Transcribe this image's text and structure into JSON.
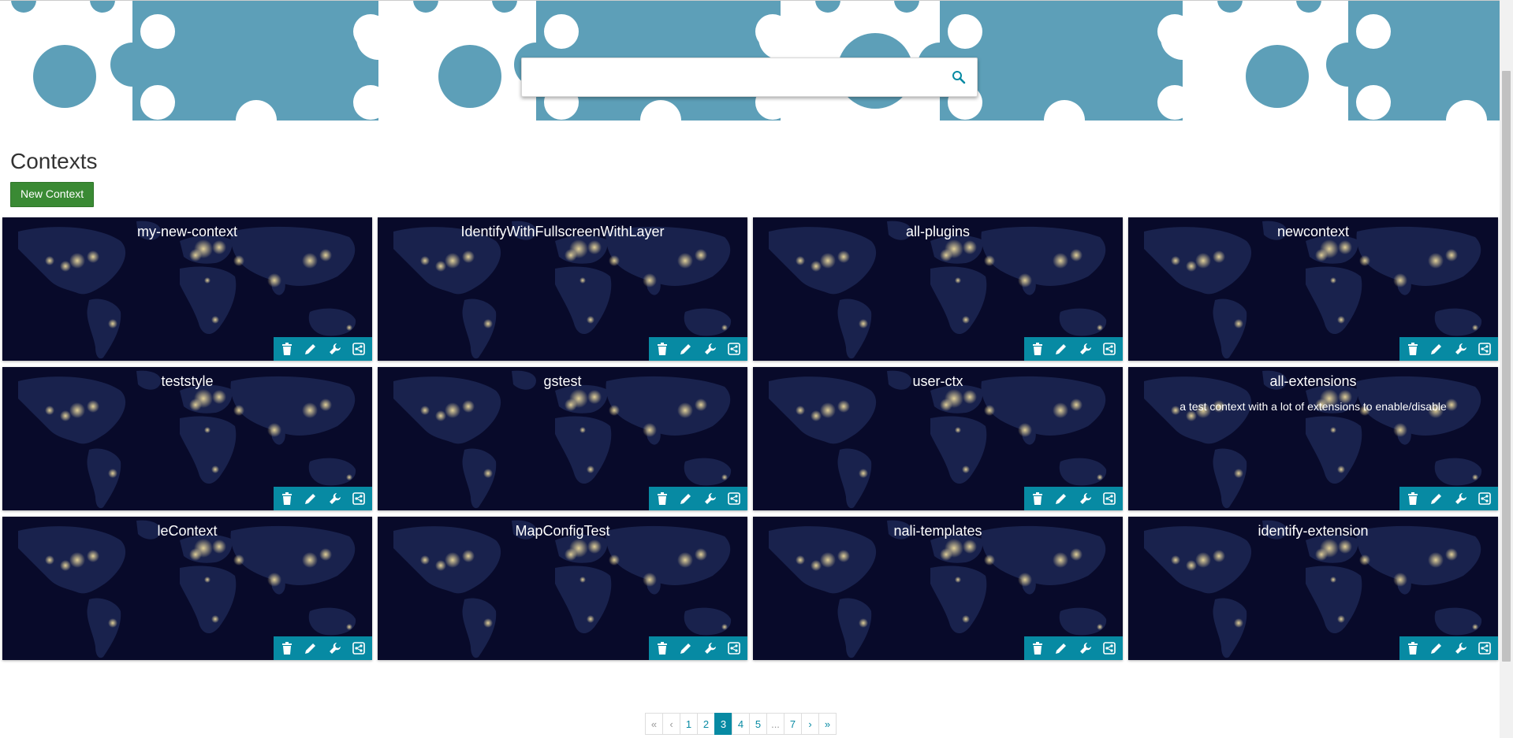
{
  "search": {
    "placeholder": ""
  },
  "page": {
    "title": "Contexts",
    "new_button": "New Context"
  },
  "colors": {
    "accent": "#078aa3",
    "banner": "#5d9fb8",
    "new_button": "#3a8a34",
    "card_bg": "#080a2a"
  },
  "cards": [
    {
      "title": "my-new-context",
      "description": ""
    },
    {
      "title": "IdentifyWithFullscreenWithLayer",
      "description": ""
    },
    {
      "title": "all-plugins",
      "description": ""
    },
    {
      "title": "newcontext",
      "description": ""
    },
    {
      "title": "teststyle",
      "description": ""
    },
    {
      "title": "gstest",
      "description": ""
    },
    {
      "title": "user-ctx",
      "description": ""
    },
    {
      "title": "all-extensions",
      "description": "a test context with a lot of extensions to enable/disable"
    },
    {
      "title": "leContext",
      "description": ""
    },
    {
      "title": "MapConfigTest",
      "description": ""
    },
    {
      "title": "nali-templates",
      "description": ""
    },
    {
      "title": "identify-extension",
      "description": ""
    }
  ],
  "card_tools": [
    "trash-icon",
    "pencil-icon",
    "wrench-icon",
    "share-icon"
  ],
  "pagination": {
    "items": [
      "«",
      "‹",
      "1",
      "2",
      "3",
      "4",
      "5",
      "...",
      "7",
      "›",
      "»"
    ],
    "active": "3"
  }
}
